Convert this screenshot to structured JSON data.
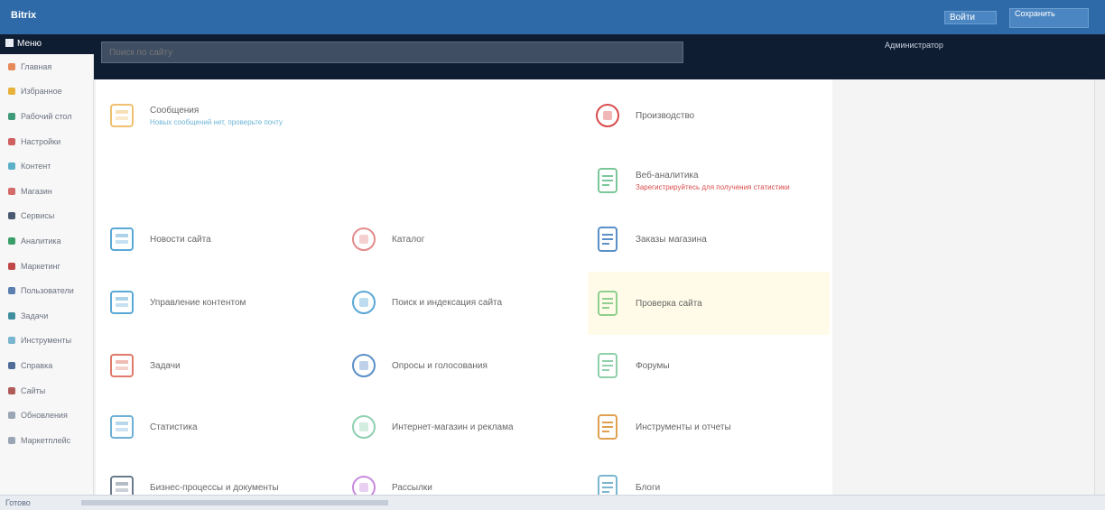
{
  "header": {
    "app_title": "Bitrix",
    "login_label": "Войти",
    "session_label": "Сохранить"
  },
  "topbar": {
    "menu_label": "Меню",
    "search_placeholder": "Поиск по сайту",
    "user_info": "Администратор"
  },
  "sidebar": {
    "items": [
      {
        "label": "Главная",
        "color": "#e68a5a"
      },
      {
        "label": "Избранное",
        "color": "#e7b23a"
      },
      {
        "label": "Рабочий стол",
        "color": "#3f9a7a"
      },
      {
        "label": "Настройки",
        "color": "#d06060"
      },
      {
        "label": "Контент",
        "color": "#5ab0c7"
      },
      {
        "label": "Магазин",
        "color": "#d46a6a"
      },
      {
        "label": "Сервисы",
        "color": "#4a5a70"
      },
      {
        "label": "Аналитика",
        "color": "#3c9f6a"
      },
      {
        "label": "Маркетинг",
        "color": "#c04848"
      },
      {
        "label": "Пользователи",
        "color": "#5a7fb0"
      },
      {
        "label": "Задачи",
        "color": "#3f8f9f"
      },
      {
        "label": "Инструменты",
        "color": "#7ab6cf"
      },
      {
        "label": "Справка",
        "color": "#4f6c9a"
      },
      {
        "label": "Сайты",
        "color": "#b05a5a"
      },
      {
        "label": "Обновления",
        "color": "#9aa6b5"
      },
      {
        "label": "Маркетплейс",
        "color": "#9aa6b5"
      }
    ]
  },
  "tiles": [
    {
      "label": "Сообщения",
      "sub": "Новых сообщений нет, проверьте почту",
      "icon": "envelope-icon",
      "color": "#f0c070",
      "subcolor": "#6fb6d6"
    },
    {
      "label": "Производство",
      "sub": "",
      "icon": "tools-icon",
      "color": "#d94c4c",
      "subcolor": ""
    },
    {
      "label": "Веб-аналитика",
      "sub": "Зарегистрируйтесь для получения статистики",
      "icon": "stats-icon",
      "color": "#7cc79a",
      "subcolor": "#d94c4c"
    },
    {
      "label": "Новости сайта",
      "sub": "",
      "icon": "news-icon",
      "color": "#5aa8d6",
      "subcolor": ""
    },
    {
      "label": "Каталог",
      "sub": "",
      "icon": "catalog-icon",
      "color": "#e38a8a",
      "subcolor": ""
    },
    {
      "label": "Заказы магазина",
      "sub": "",
      "icon": "orders-icon",
      "color": "#5a8fc7",
      "subcolor": ""
    },
    {
      "label": "Управление контентом",
      "sub": "",
      "icon": "content-icon",
      "color": "#5aa8d6",
      "subcolor": ""
    },
    {
      "label": "Поиск и индексация сайта",
      "sub": "",
      "icon": "search-index-icon",
      "color": "#5aa8d6",
      "subcolor": ""
    },
    {
      "label": "Проверка сайта",
      "sub": "",
      "icon": "check-icon",
      "color": "#8fcf8f",
      "subcolor": ""
    },
    {
      "label": "Задачи",
      "sub": "",
      "icon": "tasks-icon",
      "color": "#e07a6a",
      "subcolor": ""
    },
    {
      "label": "Опросы и голосования",
      "sub": "",
      "icon": "polls-icon",
      "color": "#5a8fc7",
      "subcolor": ""
    },
    {
      "label": "Форумы",
      "sub": "",
      "icon": "forum-icon",
      "color": "#8fcfaa",
      "subcolor": ""
    },
    {
      "label": "Статистика",
      "sub": "",
      "icon": "chart-icon",
      "color": "#6fb0d6",
      "subcolor": ""
    },
    {
      "label": "Интернет-магазин и реклама",
      "sub": "",
      "icon": "shop-icon",
      "color": "#8fcfaf",
      "subcolor": ""
    },
    {
      "label": "Инструменты и отчеты",
      "sub": "",
      "icon": "report-icon",
      "color": "#e0a050",
      "subcolor": ""
    },
    {
      "label": "Бизнес-процессы и документы",
      "sub": "",
      "icon": "bp-icon",
      "color": "#6a7a8a",
      "subcolor": ""
    },
    {
      "label": "Рассылки",
      "sub": "",
      "icon": "mail-icon",
      "color": "#c88ae0",
      "subcolor": ""
    },
    {
      "label": "Блоги",
      "sub": "",
      "icon": "blog-icon",
      "color": "#7ab6cf",
      "subcolor": ""
    }
  ],
  "statusbar": {
    "text": "Готово"
  }
}
